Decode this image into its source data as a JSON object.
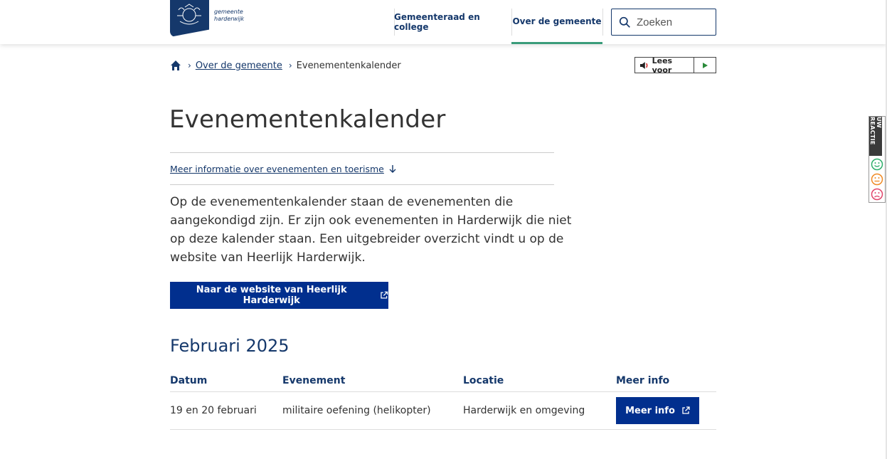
{
  "logo": {
    "line1": "gemeente",
    "line2": "harderwijk"
  },
  "nav": {
    "items": [
      {
        "label": "Gemeenteraad en college",
        "active": false
      },
      {
        "label": "Over de gemeente",
        "active": true
      }
    ],
    "search_placeholder": "Zoeken"
  },
  "breadcrumb": {
    "home_icon": "home-icon",
    "items": [
      {
        "label": "Over de gemeente "
      },
      {
        "label": "Evenementenkalender"
      }
    ]
  },
  "read_aloud": {
    "label": "Lees voor"
  },
  "page": {
    "title": "Evenementenkalender",
    "anchor_link": "Meer informatie over evenementen en toerisme",
    "intro": "Op de evenementenkalender staan de evenementen die aangekondigd zijn. Er zijn ook evenementen in Harderwijk die niet op deze kalender staan. Een uitgebreider overzicht vindt u op de website van Heerlijk Harderwijk.",
    "cta_button": "Naar de website van Heerlijk Harderwijk"
  },
  "calendar": {
    "month_heading": "Februari 2025",
    "columns": [
      "Datum",
      "Evenement",
      "Locatie",
      "Meer info"
    ],
    "rows": [
      {
        "datum": "19 en 20 februari",
        "evenement": "militaire oefening (helikopter)",
        "locatie": "Harderwijk en omgeving",
        "button": "Meer info"
      }
    ]
  },
  "feedback": {
    "label": "UW REACTIE"
  },
  "colors": {
    "brand_blue": "#15386b",
    "button_blue": "#012f8e",
    "nav_active": "#3a9c7a"
  }
}
